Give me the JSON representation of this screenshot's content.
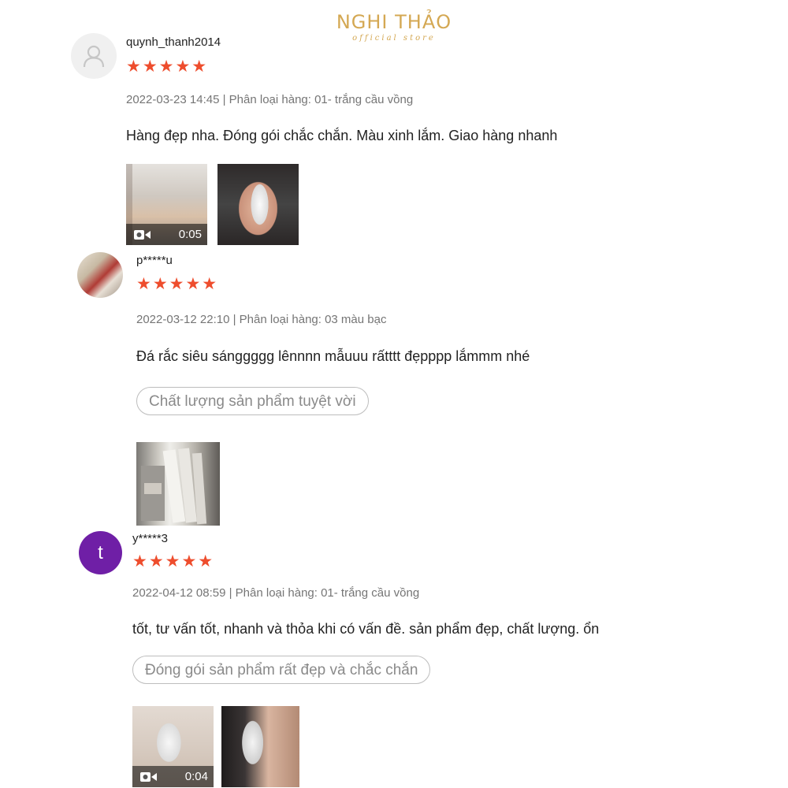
{
  "brand": {
    "name": "NGHI THẢO",
    "tagline": "official store"
  },
  "reviews": [
    {
      "username": "quynh_thanh2014",
      "stars": "★★★★★",
      "meta": "2022-03-23 14:45 | Phân loại hàng: 01- trắng cầu vồng",
      "comment": "Hàng đẹp nha. Đóng gói chắc chắn. Màu xinh lắm. Giao hàng nhanh",
      "video_duration": "0:05"
    },
    {
      "username": "p*****u",
      "stars": "★★★★★",
      "meta": "2022-03-12 22:10 | Phân loại hàng: 03 màu bạc",
      "comment": "Đá rắc siêu sánggggg lênnnn mẫuuu rấtttt đẹpppp lắmmm nhé",
      "tag": "Chất lượng sản phẩm tuyệt vời"
    },
    {
      "username": "y*****3",
      "avatar_letter": "t",
      "stars": "★★★★★",
      "meta": "2022-04-12 08:59 | Phân loại hàng: 01- trắng cầu vồng",
      "comment": "tốt, tư vấn tốt, nhanh và thỏa khi có vấn đề. sản phẩm đẹp, chất lượng. ổn",
      "tag": "Đóng gói sản phẩm rất đẹp và chắc chắn",
      "video_duration": "0:04"
    }
  ],
  "colors": {
    "star": "#ee4d2d",
    "brand": "#d4a853",
    "avatar_letter_bg": "#6f1fa6"
  },
  "icons": {
    "default_avatar": "user-silhouette-icon",
    "video": "video-camera-icon"
  }
}
